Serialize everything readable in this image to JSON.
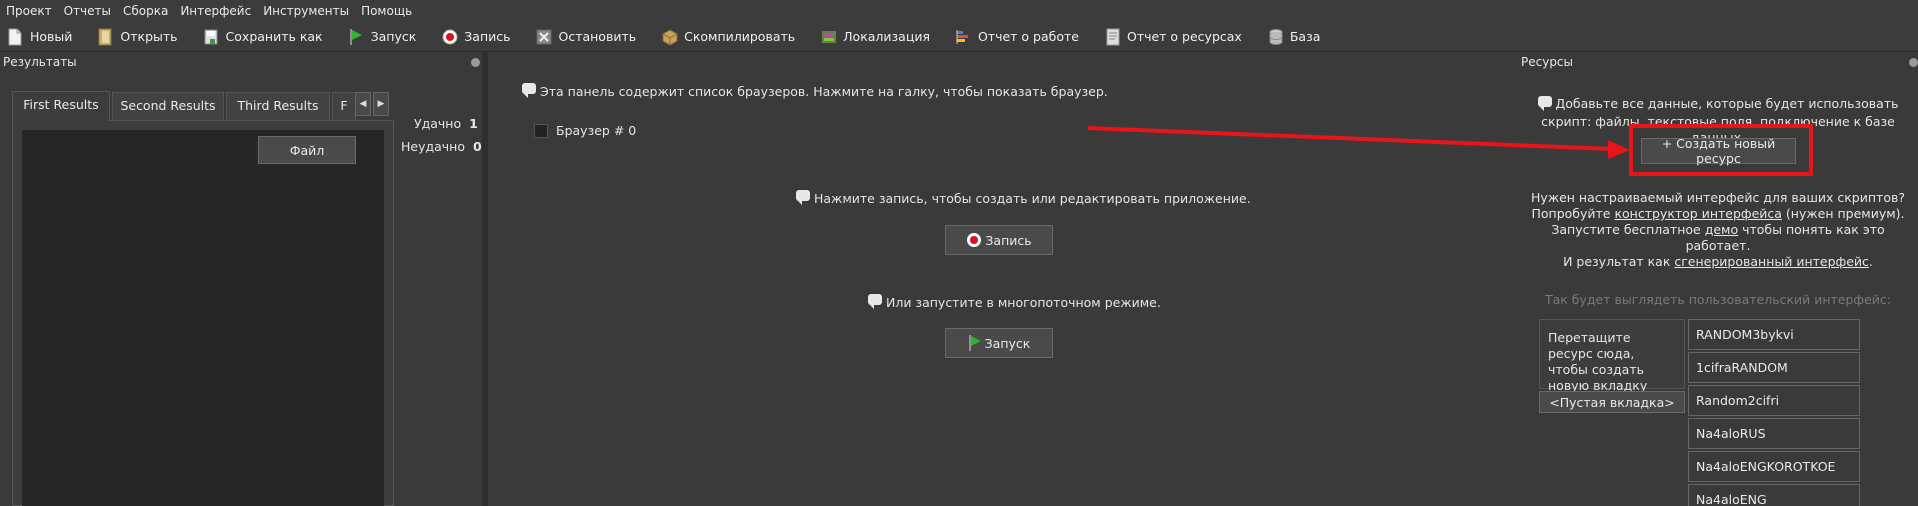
{
  "menu": [
    "Проект",
    "Отчеты",
    "Сборка",
    "Интерфейс",
    "Инструменты",
    "Помощь"
  ],
  "toolbar": {
    "new": "Новый",
    "open": "Открыть",
    "save_as": "Сохранить как",
    "run": "Запуск",
    "record": "Запись",
    "stop": "Остановить",
    "compile": "Скомпилировать",
    "localization": "Локализация",
    "work_report": "Отчет о работе",
    "resource_report": "Отчет о ресурсах",
    "database": "База"
  },
  "results_panel": {
    "title": "Результаты",
    "tabs": [
      "First Results",
      "Second Results",
      "Third Results",
      "F"
    ],
    "file_button": "Файл",
    "success_label": "Удачно",
    "success_value": "1",
    "fail_label": "Неудачно",
    "fail_value": "0"
  },
  "center": {
    "browsers_hint": "Эта панель содержит список браузеров. Нажмите на галку, чтобы показать браузер.",
    "browser_item": "Браузер # 0",
    "record_hint": "Нажмите запись, чтобы создать или редактировать приложение.",
    "record_button": "Запись",
    "multithread_hint": "Или запустите в многопоточном режиме.",
    "run_button": "Запуск"
  },
  "resources_panel": {
    "title": "Ресурсы",
    "intro_line1": "Добавьте все данные, которые будет использовать",
    "intro_line2": "скрипт: файлы, текстовые поля, подключение к базе данных.",
    "create_button": "+ Создать новый ресурс",
    "custom_ui_line1": "Нужен настраиваемый интерфейс для ваших скриптов?",
    "custom_ui_line2_pre": "Попробуйте ",
    "custom_ui_link": "конструктор интерфейса",
    "custom_ui_line2_post": " (нужен премиум).",
    "demo_line_pre": "Запустите бесплатное ",
    "demo_link": "демо",
    "demo_line_post": " чтобы понять как это",
    "demo_line2": "работает.",
    "result_line_pre": "И результат как ",
    "result_link": "сгенерированный интерфейс",
    "result_line_post": ".",
    "preview_caption": "Так будет выглядеть пользовательский интерфейс:",
    "drop_text": "Перетащите ресурс сюда, чтобы создать новую вкладку",
    "empty_tab": "<Пустая вкладка>",
    "resources": [
      "RANDOM3bykvi",
      "1cifraRANDOM",
      "Random2cifri",
      "Na4aloRUS",
      "Na4aloENGKOROTKOE",
      "Na4aloENG"
    ]
  },
  "colors": {
    "annotation_red": "#e8141a",
    "background": "#3a3a3a",
    "run_green": "#2fb52f",
    "record_red": "#d8141a"
  }
}
